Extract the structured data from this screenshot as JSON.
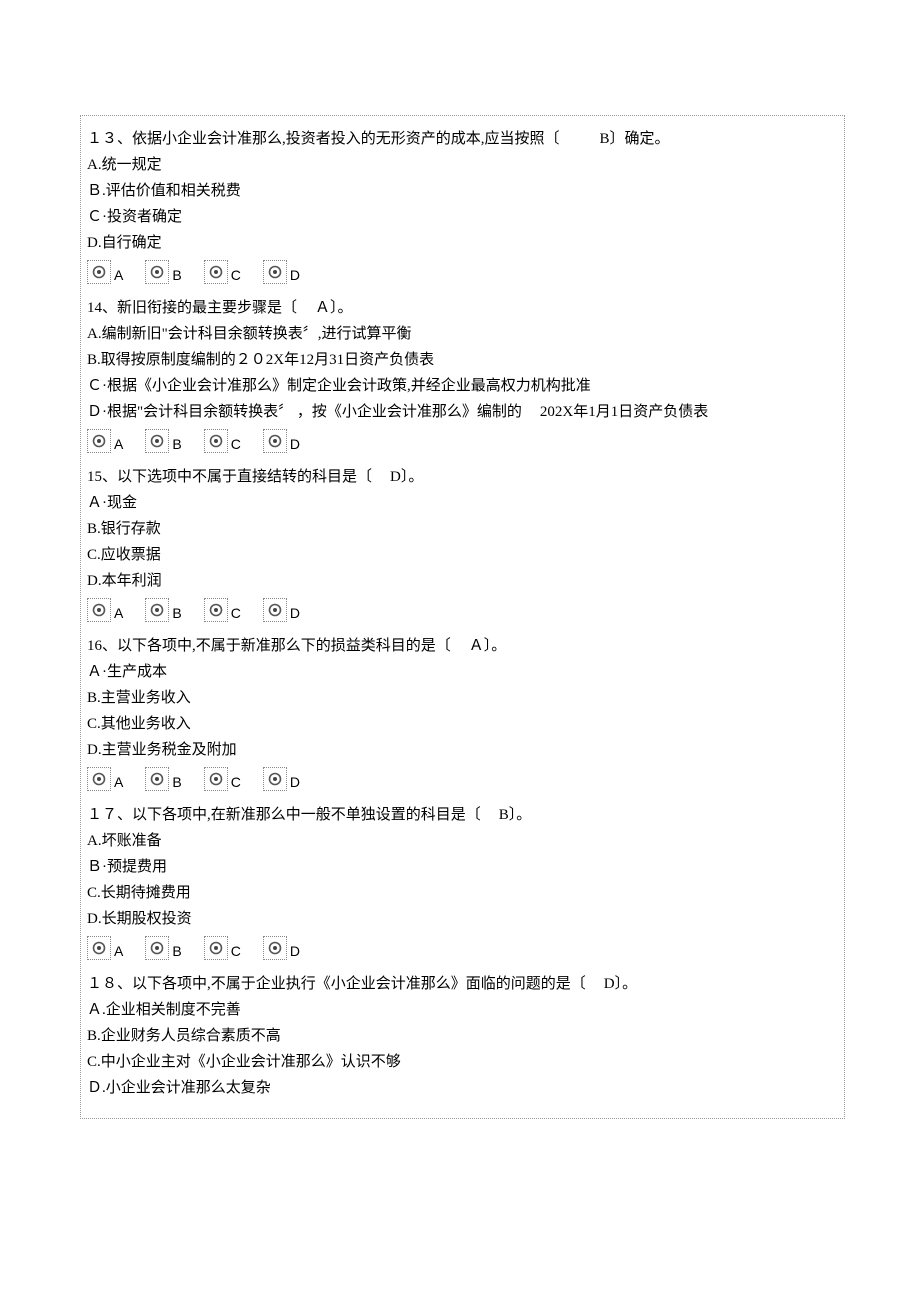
{
  "radio_labels": [
    "A",
    "B",
    "C",
    "D"
  ],
  "q13": {
    "stem_a": "１３、依据小企业会计准那么,投资者投入的无形资产的成本,应当按照〔",
    "stem_ans": "B",
    "stem_b": "〕确定。",
    "optA": "A.统一规定",
    "optB": "Ｂ.评估价值和相关税费",
    "optC": "Ｃ·投资者确定",
    "optD": "D.自行确定"
  },
  "q14": {
    "stem_a": "14、新旧衔接的最主要步骤是〔",
    "stem_ans": "Ａ",
    "stem_b": "〕。",
    "optA": "A.编制新旧\"会计科目余额转换表〞,进行试算平衡",
    "optB": "B.取得按原制度编制的２０2X年12月31日资产负债表",
    "optC": "Ｃ·根据《小企业会计准那么》制定企业会计政策,并经企业最高权力机构批准",
    "optD_a": "Ｄ·根据\"会计科目余额转换表〞 ，按《小企业会计准那么》编制的",
    "optD_b": "202X年1月1日资产负债表"
  },
  "q15": {
    "stem_a": "15、以下选项中不属于直接结转的科目是〔",
    "stem_ans": "D",
    "stem_b": "〕。",
    "optA": "Ａ·现金",
    "optB": "B.银行存款",
    "optC": "C.应收票据",
    "optD": "D.本年利润"
  },
  "q16": {
    "stem_a": "16、以下各项中,不属于新准那么下的损益类科目的是〔",
    "stem_ans": "Ａ",
    "stem_b": "〕。",
    "optA": "Ａ·生产成本",
    "optB": "B.主营业务收入",
    "optC": "C.其他业务收入",
    "optD": "D.主营业务税金及附加"
  },
  "q17": {
    "stem_a": "１７、以下各项中,在新准那么中一般不单独设置的科目是〔",
    "stem_ans": "B",
    "stem_b": "〕。",
    "optA": "A.坏账准备",
    "optB": "Ｂ·预提费用",
    "optC": "C.长期待摊费用",
    "optD": "D.长期股权投资"
  },
  "q18": {
    "stem_a": "１８、以下各项中,不属于企业执行《小企业会计准那么》面临的问题的是〔",
    "stem_ans": "D",
    "stem_b": "〕。",
    "optA": "Ａ.企业相关制度不完善",
    "optB": "B.企业财务人员综合素质不高",
    "optC": "C.中小企业主对《小企业会计准那么》认识不够",
    "optD": "Ｄ.小企业会计准那么太复杂"
  }
}
